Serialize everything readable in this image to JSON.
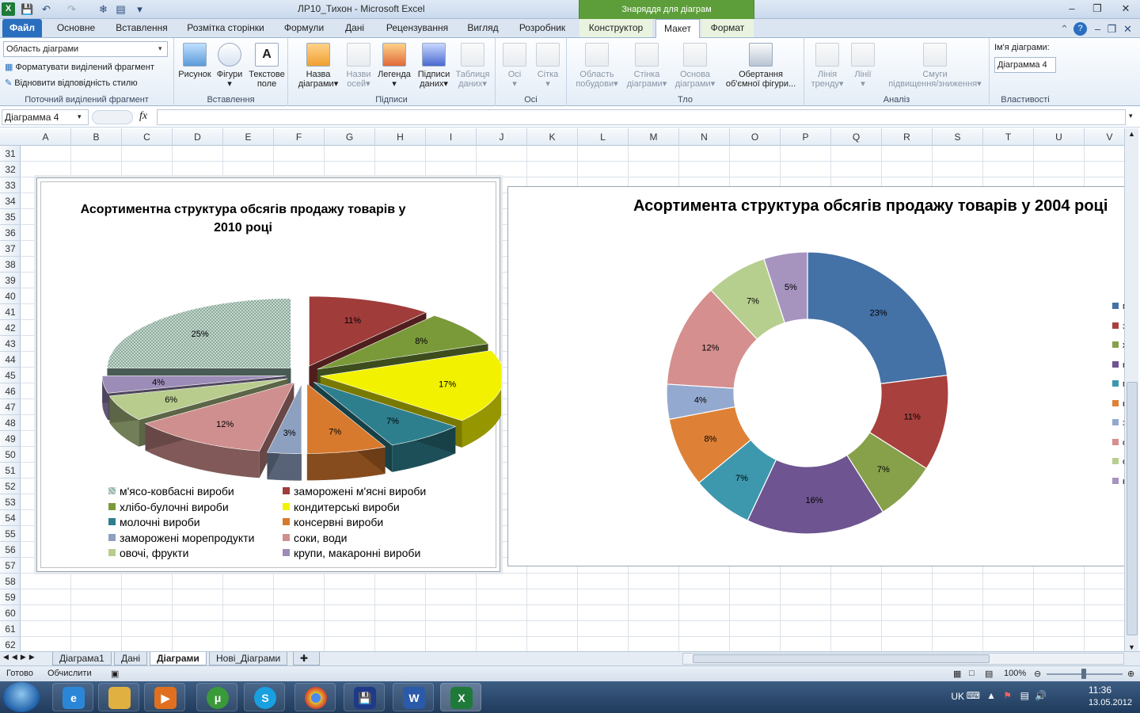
{
  "window": {
    "title": "ЛР10_Тихон  -  Microsoft Excel",
    "context_band": "Знаряддя для діаграм"
  },
  "tabs": [
    "Файл",
    "Основне",
    "Вставлення",
    "Розмітка сторінки",
    "Формули",
    "Дані",
    "Рецензування",
    "Вигляд",
    "Розробник",
    "Конструктор",
    "Макет",
    "Формат"
  ],
  "ribbon": {
    "selection_dropdown": "Область діаграми",
    "format_selection": "Форматувати виділений фрагмент",
    "reset_style": "Відновити відповідність стилю",
    "groups": {
      "current_selection": "Поточний виділений фрагмент",
      "insert": "Вставлення",
      "labels": "Підписи",
      "axes": "Осі",
      "background": "Тло",
      "analysis": "Аналіз",
      "properties": "Властивості"
    },
    "buttons": {
      "picture": "Рисунок",
      "shapes": "Фігури",
      "textbox_l1": "Текстове",
      "textbox_l2": "поле",
      "chart_title_l1": "Назва",
      "chart_title_l2": "діаграми",
      "axis_titles_l1": "Назви",
      "axis_titles_l2": "осей",
      "legend": "Легенда",
      "data_labels_l1": "Підписи",
      "data_labels_l2": "даних",
      "data_table_l1": "Таблиця",
      "data_table_l2": "даних",
      "axes": "Осі",
      "gridlines": "Сітка",
      "plot_area_l1": "Область",
      "plot_area_l2": "побудови",
      "chart_wall_l1": "Стінка",
      "chart_wall_l2": "діаграми",
      "chart_floor_l1": "Основа",
      "chart_floor_l2": "діаграми",
      "rotation_l1": "Обертання",
      "rotation_l2": "об'ємної фігури...",
      "trendline_l1": "Лінія",
      "trendline_l2": "тренду",
      "lines": "Лінії",
      "updown_l1": "Смуги",
      "updown_l2": "підвищення/зниження"
    },
    "chart_name_label": "Ім'я діаграми:",
    "chart_name_value": "Діаграмма 4"
  },
  "formula_bar": {
    "name_box": "Діаграмма 4",
    "fx": "fx"
  },
  "columns": [
    "A",
    "B",
    "C",
    "D",
    "E",
    "F",
    "G",
    "H",
    "I",
    "J",
    "K",
    "L",
    "M",
    "N",
    "O",
    "P",
    "Q",
    "R",
    "S",
    "T",
    "U",
    "V"
  ],
  "rows": [
    "31",
    "32",
    "33",
    "34",
    "35",
    "36",
    "37",
    "38",
    "39",
    "40",
    "41",
    "42",
    "43",
    "44",
    "45",
    "46",
    "47",
    "48",
    "49",
    "50",
    "51",
    "52",
    "53",
    "54",
    "55",
    "56",
    "57",
    "58",
    "59",
    "60",
    "61",
    "62"
  ],
  "chart_data": [
    {
      "type": "pie",
      "title": "Асортиментна структура обсягів продажу товарів у 2010 році",
      "categories": [
        "м'ясо-ковбасні вироби",
        "заморожені м'ясні вироби",
        "хлібо-булочні вироби",
        "кондитерські вироби",
        "молочні вироби",
        "консервні вироби",
        "заморожені морепродукти",
        "соки, води",
        "овочі, фрукти",
        "крупи, макаронні вироби"
      ],
      "values": [
        25,
        11,
        8,
        17,
        7,
        7,
        3,
        12,
        6,
        4
      ],
      "labels": [
        "25%",
        "11%",
        "8%",
        "17%",
        "7%",
        "7%",
        "3%",
        "12%",
        "6%",
        "4%"
      ],
      "colors": [
        "#8fb6a8",
        "#a03c3a",
        "#7a9a3a",
        "#f2f200",
        "#2e7f8e",
        "#d87a2e",
        "#8ea0c0",
        "#cf8f8e",
        "#b8cc8e",
        "#9c8cb8"
      ],
      "legend": "bottom"
    },
    {
      "type": "pie",
      "subtype": "doughnut",
      "title": "Асортимента структура обсягів продажу товарів у 2004 році",
      "values": [
        23,
        11,
        7,
        16,
        7,
        8,
        4,
        12,
        7,
        5
      ],
      "labels": [
        "23%",
        "11%",
        "7%",
        "16%",
        "7%",
        "8%",
        "4%",
        "12%",
        "7%",
        "5%"
      ],
      "colors": [
        "#4471a6",
        "#a8403d",
        "#87a04a",
        "#6e5490",
        "#3d98ad",
        "#de8137",
        "#94a9cf",
        "#d48f8e",
        "#b7cf8e",
        "#a694bf"
      ],
      "legend_initials": [
        "м",
        "з",
        "х",
        "к",
        "м",
        "к",
        "з",
        "с",
        "о",
        "к"
      ],
      "legend": "right"
    }
  ],
  "sheet_tabs": [
    "Діаграма1",
    "Дані",
    "Діаграми",
    "Нові_Діаграми"
  ],
  "status": {
    "ready": "Готово",
    "calculate": "Обчислити",
    "zoom": "100%"
  },
  "tray": {
    "lang": "UK",
    "time": "11:36",
    "date": "13.05.2012"
  }
}
